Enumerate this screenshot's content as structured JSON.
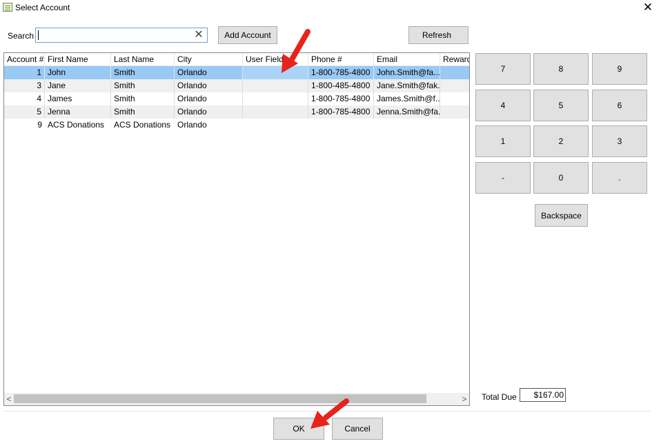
{
  "window": {
    "title": "Select Account",
    "close_glyph": "✕"
  },
  "search": {
    "label": "Search",
    "value": "",
    "clear_glyph": "✕"
  },
  "toolbar": {
    "add_account_label": "Add Account",
    "refresh_label": "Refresh"
  },
  "grid": {
    "columns": [
      "Account #",
      "First Name",
      "Last Name",
      "City",
      "User Field",
      "Phone #",
      "Email",
      "Reward"
    ],
    "rows": [
      [
        "1",
        "John",
        "Smith",
        "Orlando",
        "",
        "1-800-785-4800",
        "John.Smith@fa...",
        ""
      ],
      [
        "3",
        "Jane",
        "Smith",
        "Orlando",
        "",
        "1-800-485-4800",
        "Jane.Smith@fak...",
        ""
      ],
      [
        "4",
        "James",
        "Smith",
        "Orlando",
        "",
        "1-800-785-4800",
        "James.Smith@f...",
        ""
      ],
      [
        "5",
        "Jenna",
        "Smith",
        "Orlando",
        "",
        "1-800-785-4800",
        "Jenna.Smith@fa...",
        ""
      ],
      [
        "9",
        "ACS Donations",
        "ACS Donations",
        "Orlando",
        "",
        "",
        "",
        ""
      ]
    ],
    "selected_row": 0,
    "scroll_left_glyph": "<",
    "scroll_right_glyph": ">"
  },
  "keypad": {
    "keys": [
      "7",
      "8",
      "9",
      "4",
      "5",
      "6",
      "1",
      "2",
      "3",
      "-",
      "0",
      "."
    ],
    "backspace_label": "Backspace"
  },
  "total": {
    "label": "Total Due",
    "value": "$167.00"
  },
  "footer": {
    "ok_label": "OK",
    "cancel_label": "Cancel"
  },
  "annotation_color": "#e8231b"
}
